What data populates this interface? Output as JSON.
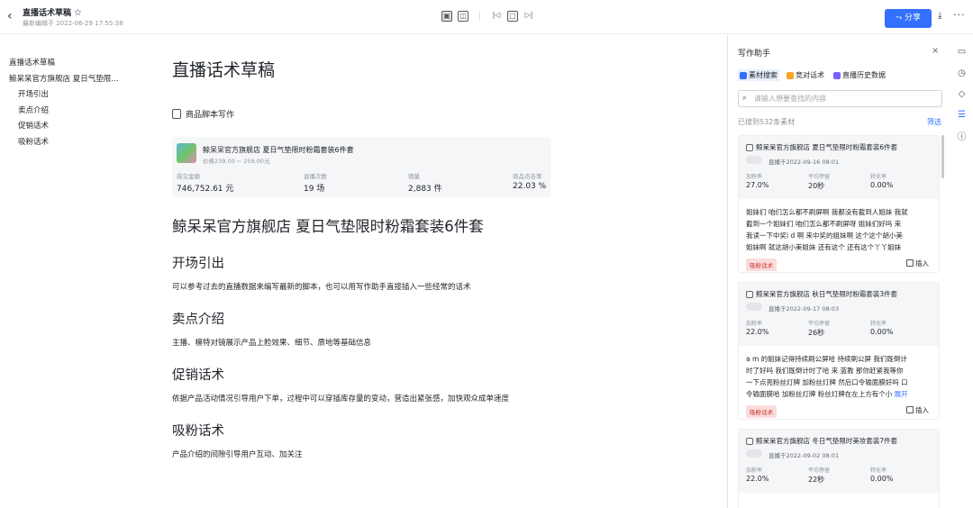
{
  "header": {
    "title": "直播话术草稿",
    "subtitle": "最新编辑于 2022-06-29 17:55:38",
    "share_label": "分享"
  },
  "toc": {
    "items": [
      {
        "label": "直播话术草稿",
        "level": 1
      },
      {
        "label": "鲸呆呆官方旗舰店 夏日气垫限…",
        "level": 1
      },
      {
        "label": "开场引出",
        "level": 2
      },
      {
        "label": "卖点介绍",
        "level": 2
      },
      {
        "label": "促销话术",
        "level": 2
      },
      {
        "label": "吸粉话术",
        "level": 2
      }
    ]
  },
  "doc": {
    "title": "直播话术草稿",
    "script_label": "商品脚本写作",
    "product": {
      "name": "鲸呆呆官方旗舰店 夏日气垫限时粉霜套装6件套",
      "price": "价格239.00 ~ 259.00元",
      "stats": [
        {
          "label": "成交金额",
          "value": "746,752.61 元"
        },
        {
          "label": "直播次数",
          "value": "19 场"
        },
        {
          "label": "销量",
          "value": "2,883 件"
        },
        {
          "label": "商品点击率",
          "value": "22.03 %"
        }
      ]
    },
    "heading": "鲸呆呆官方旗舰店 夏日气垫限时粉霜套装6件套",
    "sections": [
      {
        "title": "开场引出",
        "body": "可以参考过去的直播数据来编写最新的脚本，也可以用写作助手直接插入一些经常的话术"
      },
      {
        "title": "卖点介绍",
        "body": "主播、模特对镜展示产品上脸效果、细节、质地等基础信息"
      },
      {
        "title": "促销话术",
        "body": "依据产品活动情况引导用户下单，过程中可以穿插库存量的变动，营造出紧张感，加快观众成单速度"
      },
      {
        "title": "吸粉话术",
        "body": "产品介绍的间隙引导用户互动、加关注"
      }
    ]
  },
  "panel": {
    "title": "写作助手",
    "tabs": [
      {
        "label": "素材搜索",
        "color": "#3370ff"
      },
      {
        "label": "竞对话术",
        "color": "#f5a623"
      },
      {
        "label": "直播历史数据",
        "color": "#7b61ff"
      }
    ],
    "search_placeholder": "请输入想要查找的内容",
    "found_text": "已搜到532条素材",
    "filter_label": "筛选",
    "results": [
      {
        "title": "鲸呆呆官方旗舰店 夏日气垫限时粉霜套装6件套",
        "date": "直播于2022-09-16 08:01",
        "stats": [
          {
            "label": "加粉率",
            "value": "27.0%"
          },
          {
            "label": "平均停留",
            "value": "20秒"
          },
          {
            "label": "转化率",
            "value": "0.00%"
          }
        ],
        "lines": [
          "姐妹们 咱们怎么都不刷屏啊 我都没有截到人姐妹 我就",
          "截到一个姐妹们 咱们怎么都不刷屏呀 姐妹们好吗 来",
          "我读一下中奖i d 啊 来中奖的姐妹啊 这个这个胡小美",
          "姐妹啊 就这胡小美姐妹 还有这个 还有这个丫丫姐妹"
        ],
        "more": "",
        "tag": "吸粉话术",
        "insert": "插入"
      },
      {
        "title": "鲸呆呆官方旗舰店 秋日气垫限时粉霜套装3件套",
        "date": "直播于2022-09-17 08:03",
        "stats": [
          {
            "label": "加粉率",
            "value": "22.0%"
          },
          {
            "label": "平均停留",
            "value": "26秒"
          },
          {
            "label": "转化率",
            "value": "0.00%"
          }
        ],
        "lines": [
          "a m 的姐妹记得持续刷公屏哈 持续刷公屏 我们既倒计",
          "时了好吗 我们既倒计时了哈 来 蓝教 那你赶紧我等你",
          "一下点亮粉丝灯牌 加粉丝灯牌 然后口令输面膜好吗 口",
          "令输面膜哈 加粉丝灯牌 粉丝灯牌在左上方有个小"
        ],
        "more": "展开",
        "tag": "吸粉话术",
        "insert": "插入"
      },
      {
        "title": "鲸呆呆官方旗舰店 冬日气垫限时美妆套装7件套",
        "date": "直播于2022-09-02 08:01",
        "stats": [
          {
            "label": "加粉率",
            "value": "22.0%"
          },
          {
            "label": "平均停留",
            "value": "22秒"
          },
          {
            "label": "转化率",
            "value": "0.00%"
          }
        ],
        "lines": [],
        "more": "",
        "tag": "",
        "insert": ""
      }
    ]
  }
}
